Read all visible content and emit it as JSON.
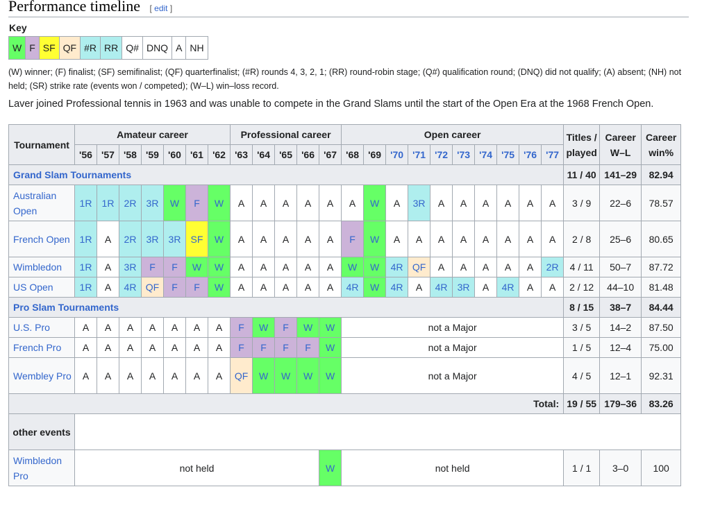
{
  "heading": {
    "title": "Performance timeline",
    "edit": "edit"
  },
  "key": {
    "title": "Key",
    "items": [
      {
        "label": "W",
        "color": "#66ff66"
      },
      {
        "label": "F",
        "color": "#ccb3d9"
      },
      {
        "label": "SF",
        "color": "#ffff33"
      },
      {
        "label": "QF",
        "color": "#ffebcd"
      },
      {
        "label": "#R",
        "color": "#afeeee"
      },
      {
        "label": "RR",
        "color": "#afeeee"
      },
      {
        "label": "Q#",
        "color": "#ffffff"
      },
      {
        "label": "DNQ",
        "color": "#ffffff"
      },
      {
        "label": "A",
        "color": "#ffffff"
      },
      {
        "label": "NH",
        "color": "#ffffff"
      }
    ],
    "legend": "(W) winner; (F) finalist; (SF) semifinalist; (QF) quarterfinalist; (#R) rounds 4, 3, 2, 1; (RR) round-robin stage; (Q#) qualification round; (DNQ) did not qualify; (A) absent; (NH) not held; (SR) strike rate (events won / competed); (W–L) win–loss record."
  },
  "intro": "Laver joined Professional tennis in 1963 and was unable to compete in the Grand Slams until the start of the Open Era at the 1968 French Open.",
  "table": {
    "tournament_header": "Tournament",
    "groups": [
      "Amateur career",
      "Professional career",
      "Open career"
    ],
    "years_amateur": [
      "'56",
      "'57",
      "'58",
      "'59",
      "'60",
      "'61",
      "'62"
    ],
    "years_pro": [
      "'63",
      "'64",
      "'65",
      "'66",
      "'67"
    ],
    "years_open": [
      "'68",
      "'69",
      "'70",
      "'71",
      "'72",
      "'73",
      "'74",
      "'75",
      "'76",
      "'77"
    ],
    "linked_years": [
      "'70",
      "'71",
      "'72",
      "'73",
      "'74",
      "'75",
      "'76",
      "'77"
    ],
    "titles_header": "Titles / played",
    "wl_header": "Career W–L",
    "win_header": "Career win%",
    "gs_section": {
      "label": "Grand Slam Tournaments",
      "titles": "11 / 40",
      "wl": "141–29",
      "win": "82.94"
    },
    "gs_rows": [
      {
        "name": "Australian Open",
        "cells": [
          "1R",
          "1R",
          "2R",
          "3R",
          "W",
          "F",
          "W",
          "A",
          "A",
          "A",
          "A",
          "A",
          "A",
          "W",
          "A",
          "3R",
          "A",
          "A",
          "A",
          "A",
          "A",
          "A"
        ],
        "titles": "3 / 9",
        "wl": "22–6",
        "win": "78.57"
      },
      {
        "name": "French Open",
        "cells": [
          "1R",
          "A",
          "2R",
          "3R",
          "3R",
          "SF",
          "W",
          "A",
          "A",
          "A",
          "A",
          "A",
          "F",
          "W",
          "A",
          "A",
          "A",
          "A",
          "A",
          "A",
          "A",
          "A"
        ],
        "titles": "2 / 8",
        "wl": "25–6",
        "win": "80.65"
      },
      {
        "name": "Wimbledon",
        "cells": [
          "1R",
          "A",
          "3R",
          "F",
          "F",
          "W",
          "W",
          "A",
          "A",
          "A",
          "A",
          "A",
          "W",
          "W",
          "4R",
          "QF",
          "A",
          "A",
          "A",
          "A",
          "A",
          "2R"
        ],
        "titles": "4 / 11",
        "wl": "50–7",
        "win": "87.72"
      },
      {
        "name": "US Open",
        "cells": [
          "1R",
          "A",
          "4R",
          "QF",
          "F",
          "F",
          "W",
          "A",
          "A",
          "A",
          "A",
          "A",
          "4R",
          "W",
          "4R",
          "A",
          "4R",
          "3R",
          "A",
          "4R",
          "A",
          "A"
        ],
        "titles": "2 / 12",
        "wl": "44–10",
        "win": "81.48"
      }
    ],
    "pro_section": {
      "label": "Pro Slam Tournaments",
      "titles": "8 / 15",
      "wl": "38–7",
      "win": "84.44"
    },
    "pro_rows": [
      {
        "name": "U.S. Pro",
        "cells": [
          "A",
          "A",
          "A",
          "A",
          "A",
          "A",
          "A",
          "F",
          "W",
          "F",
          "W",
          "W"
        ],
        "note": "not a Major",
        "titles": "3 / 5",
        "wl": "14–2",
        "win": "87.50"
      },
      {
        "name": "French Pro",
        "cells": [
          "A",
          "A",
          "A",
          "A",
          "A",
          "A",
          "A",
          "F",
          "F",
          "F",
          "F",
          "W"
        ],
        "note": "not a Major",
        "titles": "1 / 5",
        "wl": "12–4",
        "win": "75.00"
      },
      {
        "name": "Wembley Pro",
        "cells": [
          "A",
          "A",
          "A",
          "A",
          "A",
          "A",
          "A",
          "QF",
          "W",
          "W",
          "W",
          "W"
        ],
        "note": "not a Major",
        "titles": "4 / 5",
        "wl": "12–1",
        "win": "92.31"
      }
    ],
    "total": {
      "label": "Total:",
      "titles": "19 / 55",
      "wl": "179–36",
      "win": "83.26"
    },
    "other_label": "other events",
    "other_rows": [
      {
        "name": "Wimbledon Pro",
        "before": "not held",
        "cell": "W",
        "after": "not held",
        "titles": "1 / 1",
        "wl": "3–0",
        "win": "100"
      }
    ]
  }
}
